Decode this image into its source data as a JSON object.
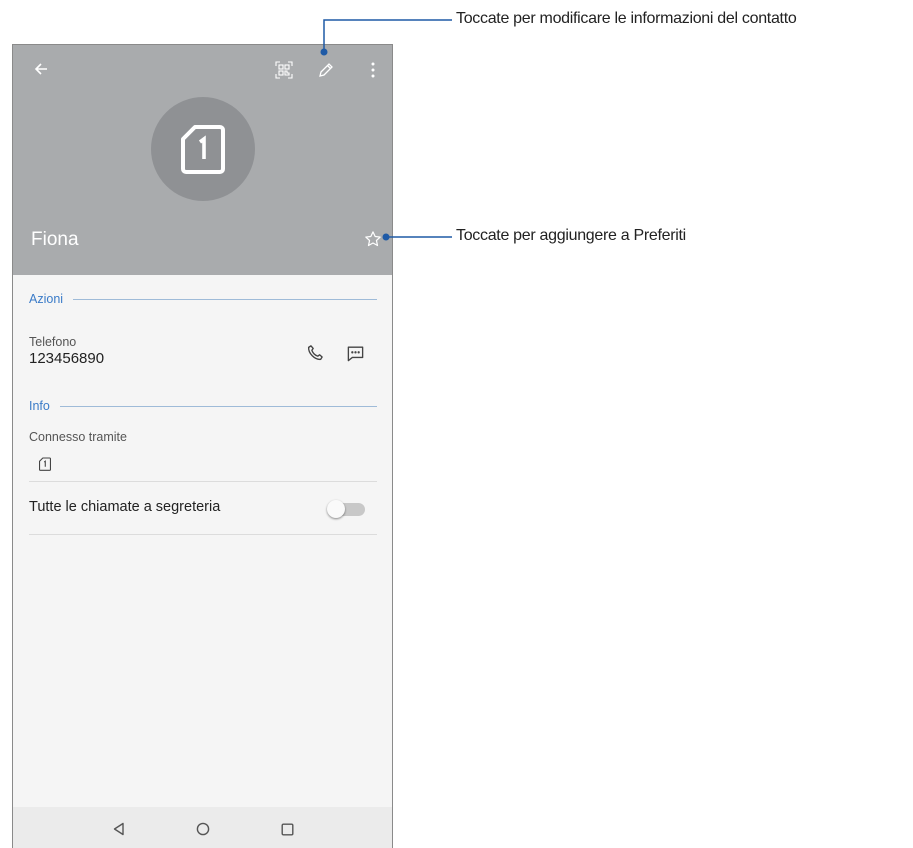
{
  "header": {
    "contact_name": "Fiona",
    "icons": [
      "back-arrow-icon",
      "qr-code-icon",
      "edit-pencil-icon",
      "more-vert-icon",
      "sim-card-icon",
      "star-outline-icon"
    ]
  },
  "sections": {
    "actions_title": "Azioni",
    "info_title": "Info"
  },
  "phone_entry": {
    "label": "Telefono",
    "number": "123456890"
  },
  "info": {
    "connected_via_label": "Connesso tramite"
  },
  "voicemail_setting": {
    "label": "Tutte le chiamate a segreteria",
    "enabled": false
  },
  "callouts": {
    "edit": "Toccate per modificare le informazioni del contatto",
    "favorite": "Toccate per aggiungere a Preferiti"
  },
  "colors": {
    "header_bg": "#a9abad",
    "accent": "#3a7bc8",
    "callout_line": "#1f5aa6"
  }
}
